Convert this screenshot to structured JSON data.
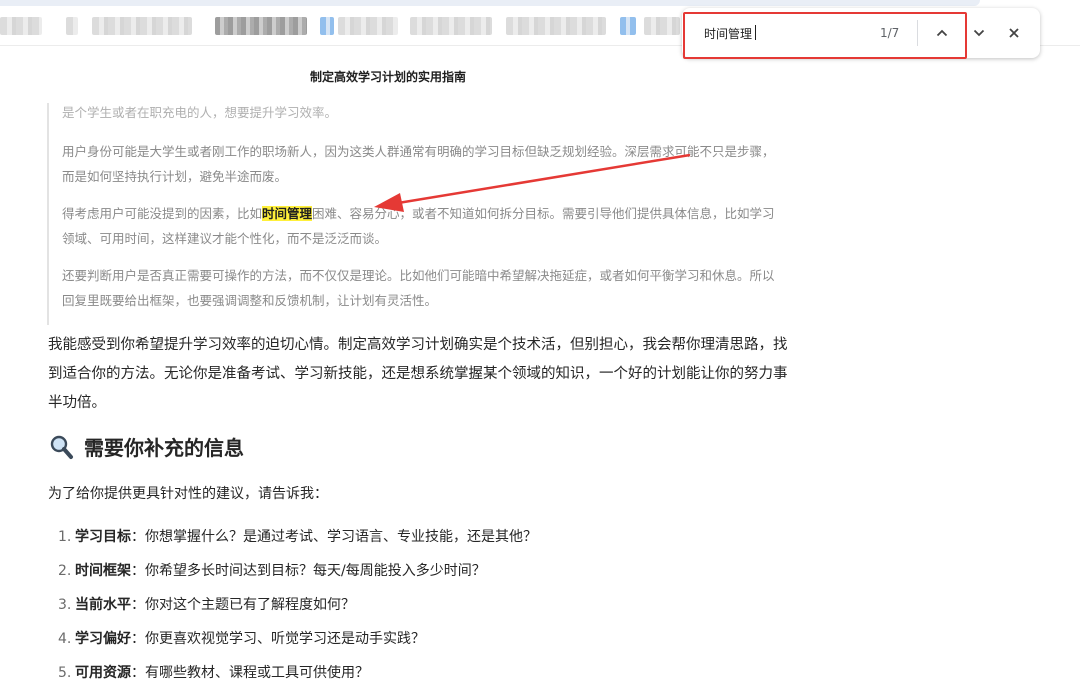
{
  "find_bar": {
    "query": "时间管理",
    "count": "1/7",
    "prev_icon": "chevron-up-icon",
    "next_icon": "chevron-down-icon",
    "close_icon": "close-icon"
  },
  "document": {
    "title": "制定高效学习计划的实用指南",
    "thinking": {
      "p1": "是个学生或者在职充电的人，想要提升学习效率。",
      "p2": "用户身份可能是大学生或者刚工作的职场新人，因为这类人群通常有明确的学习目标但缺乏规划经验。深层需求可能不只是步骤，而是如何坚持执行计划，避免半途而废。",
      "p3_before": "得考虑用户可能没提到的因素，比如",
      "p3_highlight": "时间管理",
      "p3_after": "困难、容易分心，或者不知道如何拆分目标。需要引导他们提供具体信息，比如学习领域、可用时间，这样建议才能个性化，而不是泛泛而谈。",
      "p4": "还要判断用户是否真正需要可操作的方法，而不仅仅是理论。比如他们可能暗中希望解决拖延症，或者如何平衡学习和休息。所以回复里既要给出框架，也要强调调整和反馈机制，让计划有灵活性。"
    },
    "main_paragraph": "我能感受到你希望提升学习效率的迫切心情。制定高效学习计划确实是个技术活，但别担心，我会帮你理清思路，找到适合你的方法。无论你是准备考试、学习新技能，还是想系统掌握某个领域的知识，一个好的计划能让你的努力事半功倍。",
    "section_icon": "magnifier-icon",
    "section_title": "需要你补充的信息",
    "intro": "为了给你提供更具针对性的建议，请告诉我：",
    "questions": [
      {
        "num": "1.",
        "label": "学习目标",
        "text": "：你想掌握什么？是通过考试、学习语言、专业技能，还是其他？"
      },
      {
        "num": "2.",
        "label": "时间框架",
        "text": "：你希望多长时间达到目标？每天/每周能投入多少时间？"
      },
      {
        "num": "3.",
        "label": "当前水平",
        "text": "：你对这个主题已有了解程度如何？"
      },
      {
        "num": "4.",
        "label": "学习偏好",
        "text": "：你更喜欢视觉学习、听觉学习还是动手实践？"
      },
      {
        "num": "5.",
        "label": "可用资源",
        "text": "：有哪些教材、课程或工具可供使用？"
      }
    ]
  },
  "colors": {
    "highlight": "#fff03a",
    "annotation_red": "#e53935"
  }
}
